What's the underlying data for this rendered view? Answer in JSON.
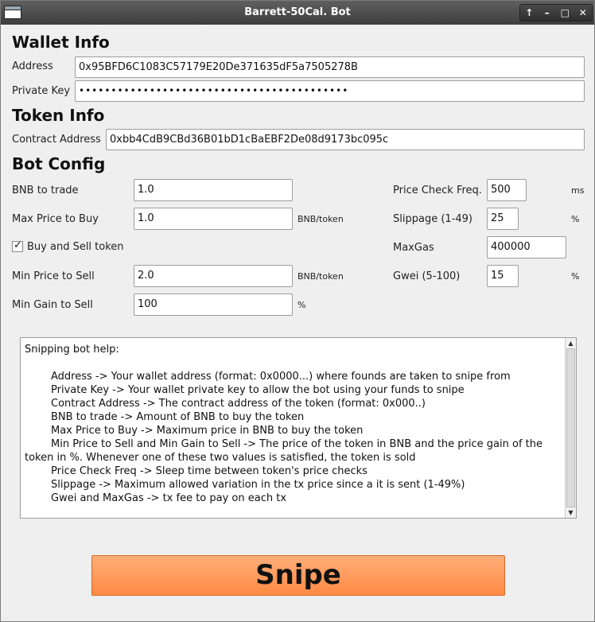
{
  "window": {
    "title": "Barrett-50Cal. Bot"
  },
  "titlebar": {
    "controls": [
      "↑",
      "–",
      "□",
      "✕"
    ]
  },
  "wallet": {
    "heading": "Wallet Info",
    "address_label": "Address",
    "address_value": "0x95BFD6C1083C57179E20De371635dF5a7505278B",
    "private_key_label": "Private Key",
    "private_key_value": "••••••••••••••••••••••••••••••••••••••••••"
  },
  "token": {
    "heading": "Token Info",
    "contract_label": "Contract Address",
    "contract_value": "0xbb4CdB9CBd36B01bD1cBaEBF2De08d9173bc095c"
  },
  "config": {
    "heading": "Bot Config",
    "bnb_trade_label": "BNB to trade",
    "bnb_trade_value": "1.0",
    "max_price_label": "Max Price to Buy",
    "max_price_value": "1.0",
    "max_price_unit": "BNB/token",
    "buy_sell_label": "Buy and Sell token",
    "buy_sell_checked": "✓",
    "min_price_label": "Min Price to Sell",
    "min_price_value": "2.0",
    "min_price_unit": "BNB/token",
    "min_gain_label": "Min Gain to Sell",
    "min_gain_value": "100",
    "min_gain_unit": "%",
    "price_freq_label": "Price Check Freq.",
    "price_freq_value": "500",
    "price_freq_unit": "ms",
    "slippage_label": "Slippage (1-49)",
    "slippage_value": "25",
    "slippage_unit": "%",
    "maxgas_label": "MaxGas",
    "maxgas_value": "400000",
    "gwei_label": "Gwei (5-100)",
    "gwei_value": "15",
    "gwei_unit": "%"
  },
  "help": {
    "title": "Snipping bot help:",
    "lines": [
      "Address -> Your wallet address (format: 0x0000...) where founds are taken to snipe from",
      "Private Key -> Your wallet private key to allow the bot using your funds to snipe",
      "Contract Address -> The contract address of the token (format: 0x000..)",
      "BNB to trade -> Amount of BNB to buy the token",
      "Max Price to Buy -> Maximum price in BNB to buy the token",
      "Min Price to Sell and Min Gain to Sell -> The price of the token in BNB and the price gain of the",
      "token in %. Whenever one of these two values is satisfied, the token is sold",
      "Price Check Freq -> Sleep time between token's price checks",
      "Slippage -> Maximum allowed variation in the tx price since a it is sent (1-49%)",
      "Gwei and MaxGas -> tx fee to pay on each tx"
    ]
  },
  "action": {
    "snipe_label": "Snipe"
  }
}
